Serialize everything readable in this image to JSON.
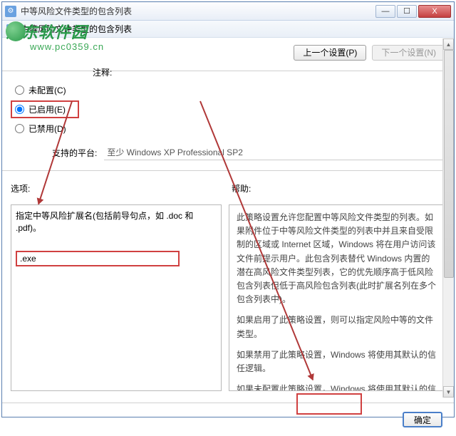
{
  "title": "中等风险文件类型的包含列表",
  "subtitle": "中等风险文件类型的包含列表",
  "window_buttons": {
    "min": "—",
    "max": "☐",
    "close": "X"
  },
  "nav": {
    "prev": "上一个设置(P)",
    "next": "下一个设置(N)"
  },
  "radios": {
    "unconfigured": "未配置(C)",
    "comment_label": "注释:",
    "enabled": "已启用(E)",
    "disabled": "已禁用(D)"
  },
  "platform": {
    "label": "支持的平台:",
    "value": "至少 Windows XP Professional SP2"
  },
  "sections": {
    "options": "选项:",
    "help": "帮助:"
  },
  "left_text": "指定中等风险扩展名(包括前导句点，如 .doc 和 .pdf)。",
  "input_value": ".exe",
  "help_paras": [
    "此策略设置允许您配置中等风险文件类型的列表。如果附件位于中等风险文件类型的列表中并且来自受限制的区域或 Internet 区域，Windows 将在用户访问该文件前提示用户。此包含列表替代 Windows 内置的潜在高风险文件类型列表，它的优先顺序高于低风险包含列表但低于高风险包含列表(此时扩展名列在多个包含列表中)。",
    "如果启用了此策略设置，则可以指定风险中等的文件类型。",
    "如果禁用了此策略设置，Windows 将使用其默认的信任逻辑。",
    "如果未配置此策略设置，Windows 将使用其默认的信任逻辑。"
  ],
  "footer": {
    "ok": "确定"
  },
  "watermark": {
    "l1": "河东软件园",
    "l2": "www.pc0359.cn"
  }
}
